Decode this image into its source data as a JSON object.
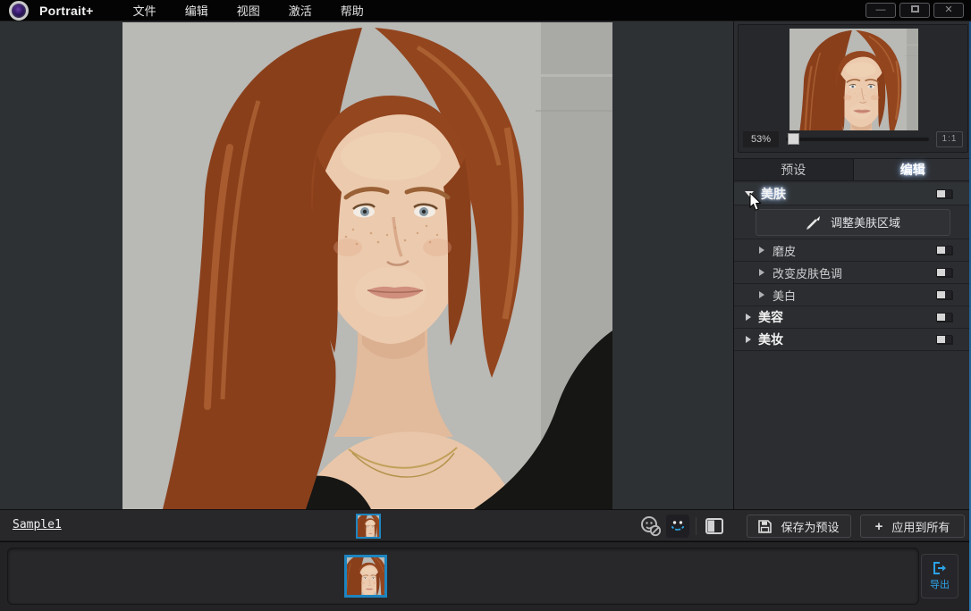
{
  "window": {
    "app_title": "Portrait+",
    "minimize": "—",
    "close": "✕"
  },
  "menu": {
    "items": [
      "文件",
      "编辑",
      "视图",
      "激活",
      "帮助"
    ]
  },
  "navigator": {
    "zoom": "53%",
    "one_to_one": "1:1"
  },
  "tabs": [
    {
      "label": "预设",
      "active": false
    },
    {
      "label": "编辑",
      "active": true
    }
  ],
  "panel": {
    "sections": [
      {
        "label": "美肤",
        "level": 1,
        "expanded": true
      },
      {
        "label": "磨皮",
        "level": 2,
        "expanded": false
      },
      {
        "label": "改变皮肤色调",
        "level": 2,
        "expanded": false
      },
      {
        "label": "美白",
        "level": 2,
        "expanded": false
      },
      {
        "label": "美容",
        "level": 1,
        "expanded": false
      },
      {
        "label": "美妆",
        "level": 1,
        "expanded": false
      }
    ],
    "adjust_area_button": "调整美肤区域"
  },
  "statusbar": {
    "filename": "Sample1",
    "save_preset": "保存为预设",
    "apply_all": "应用到所有"
  },
  "filmstrip": {
    "export_label": "导出"
  },
  "icons": {
    "logo": "lens-circle",
    "save": "floppy-disk",
    "apply": "plus",
    "export": "door-arrow",
    "face_detect_off": "face-slash",
    "landmarks": "smiley-points",
    "split_view": "half-filled-square",
    "brush": "paintbrush"
  },
  "colors": {
    "accent_blue": "#2ba3e8",
    "selection_border": "#1d85c0",
    "panel_bg": "#2b2d30",
    "canvas_bg": "#2e3134",
    "photo_bg": "#b9b9b5"
  }
}
